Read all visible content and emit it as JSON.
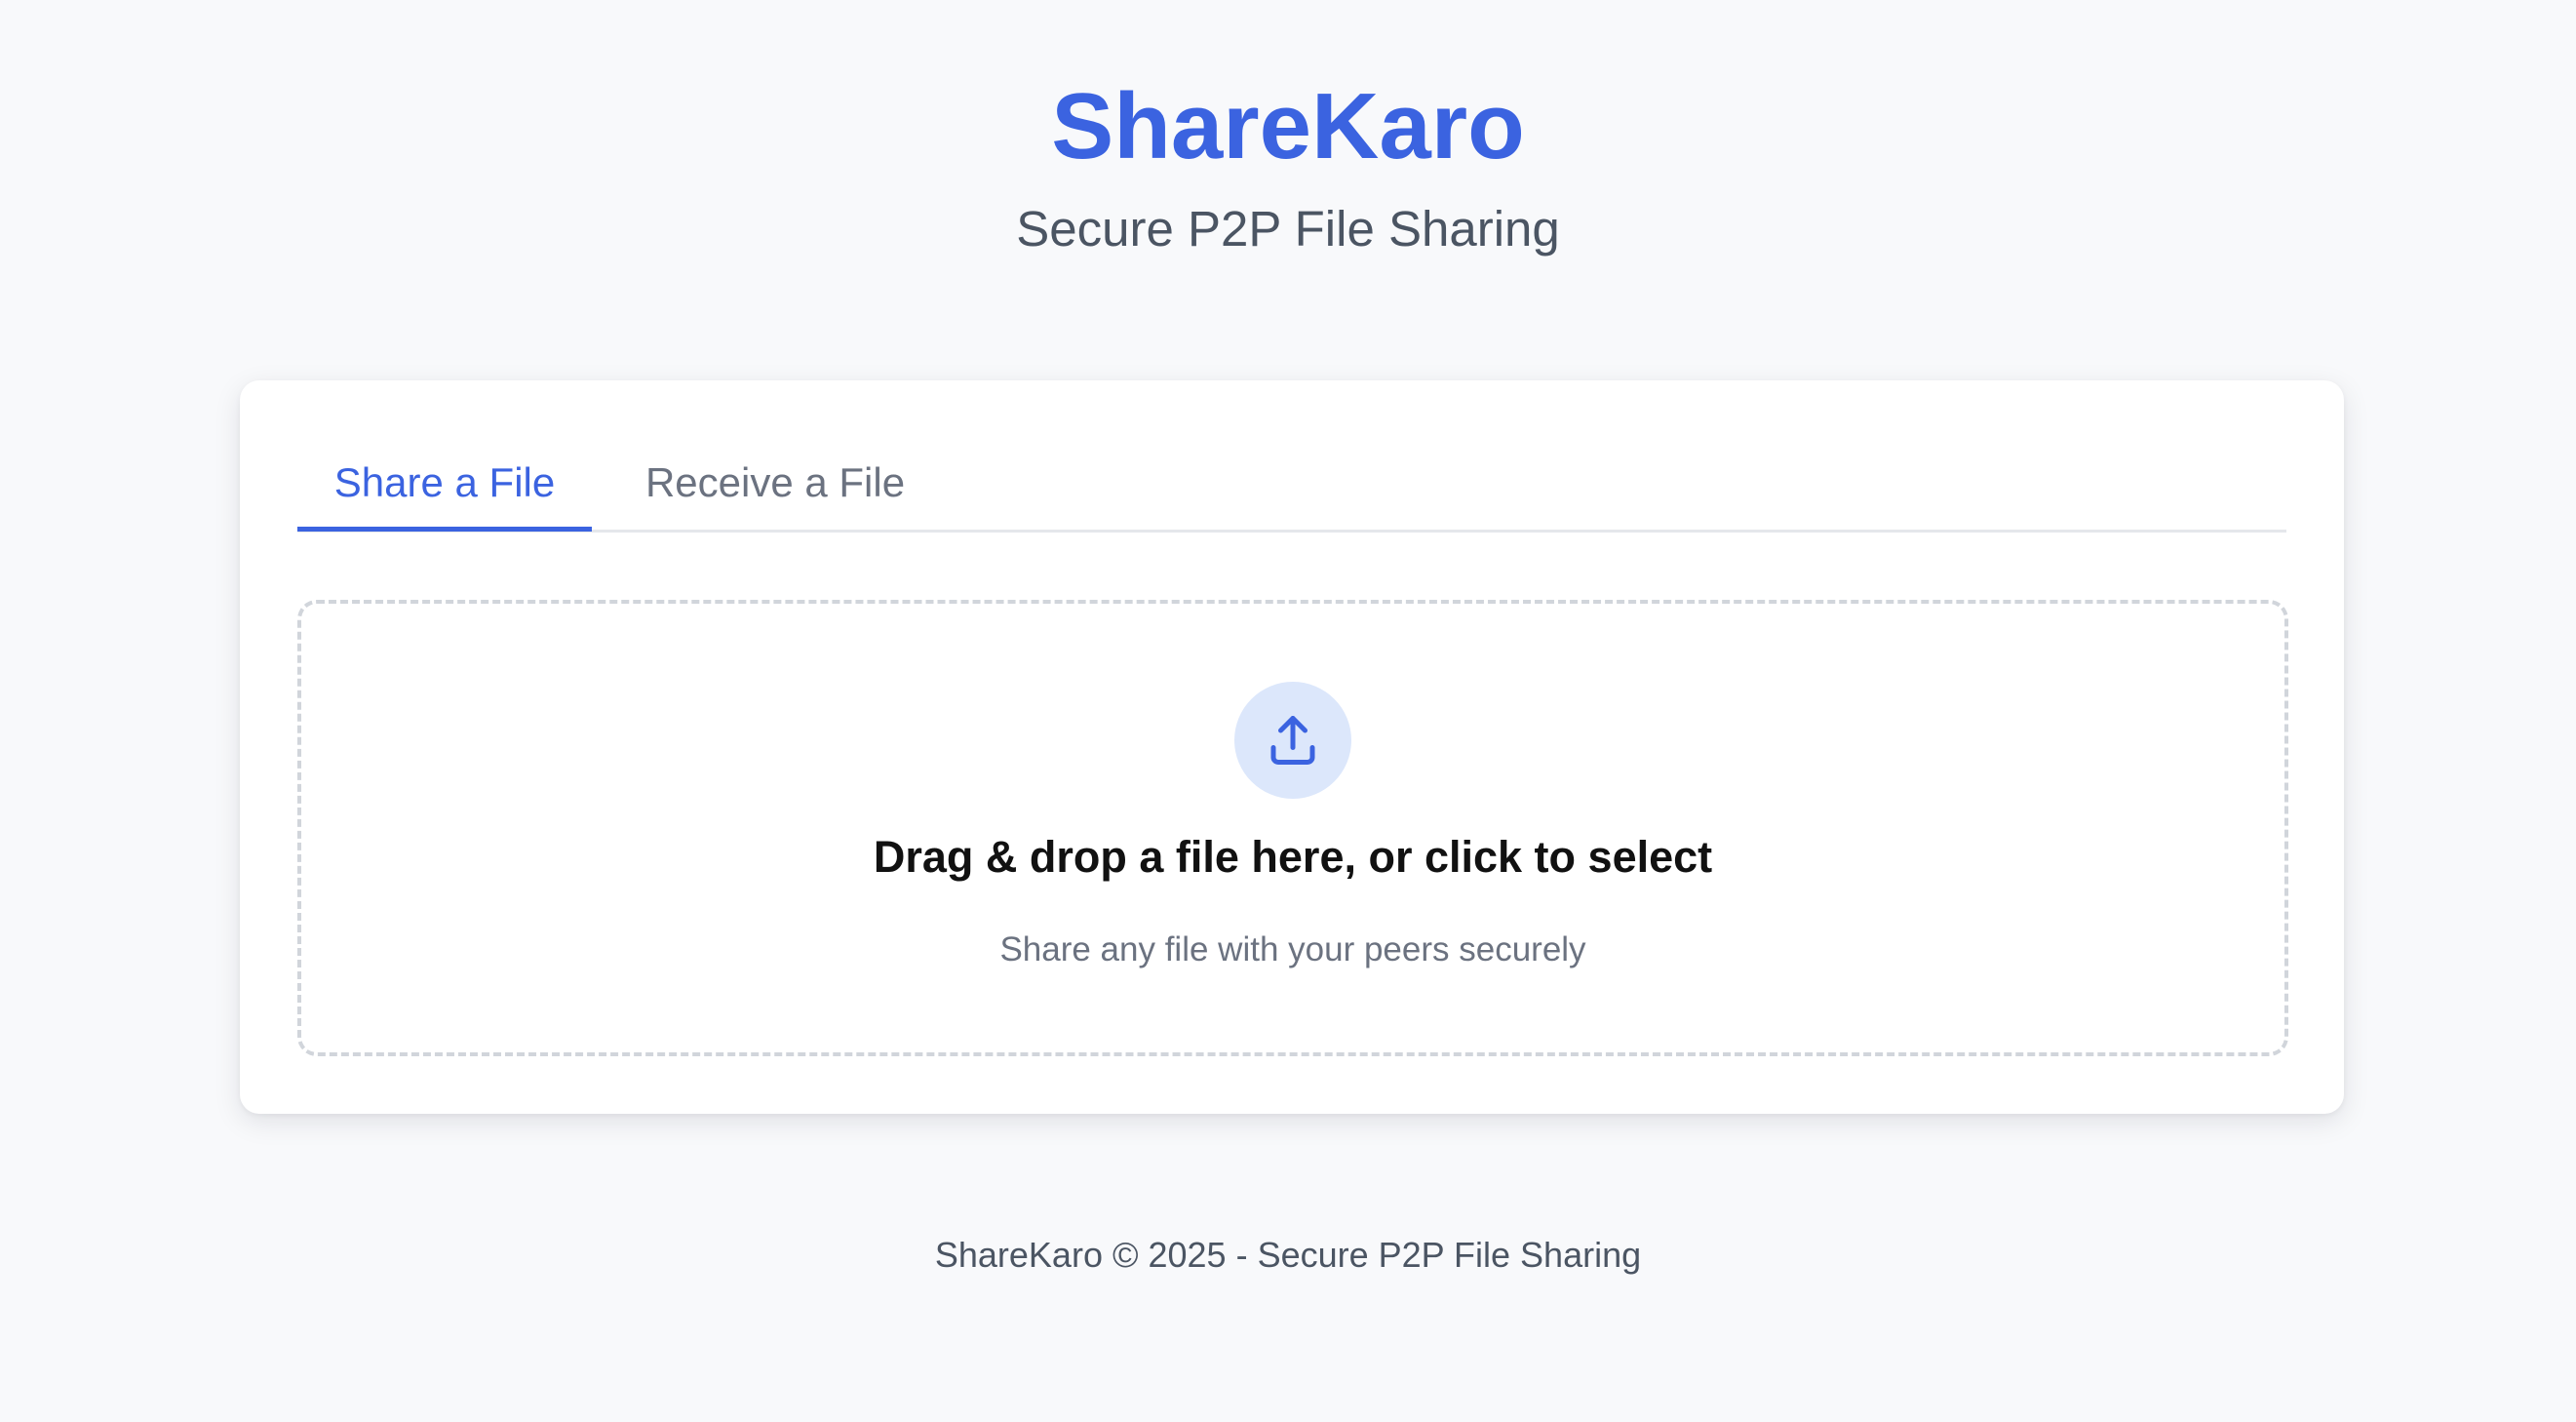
{
  "app": {
    "title": "ShareKaro",
    "subtitle": "Secure P2P File Sharing"
  },
  "tabs": [
    {
      "label": "Share a File",
      "active": true
    },
    {
      "label": "Receive a File",
      "active": false
    }
  ],
  "dropzone": {
    "icon": "upload-icon",
    "title": "Drag & drop a file here, or click to select",
    "subtitle": "Share any file with your peers securely"
  },
  "footer": {
    "text": "ShareKaro © 2025 - Secure P2P File Sharing"
  },
  "colors": {
    "accent": "#3b63e0",
    "background": "#f8f9fb",
    "icon_circle": "#dce7fb",
    "muted_text": "#6b7280"
  }
}
